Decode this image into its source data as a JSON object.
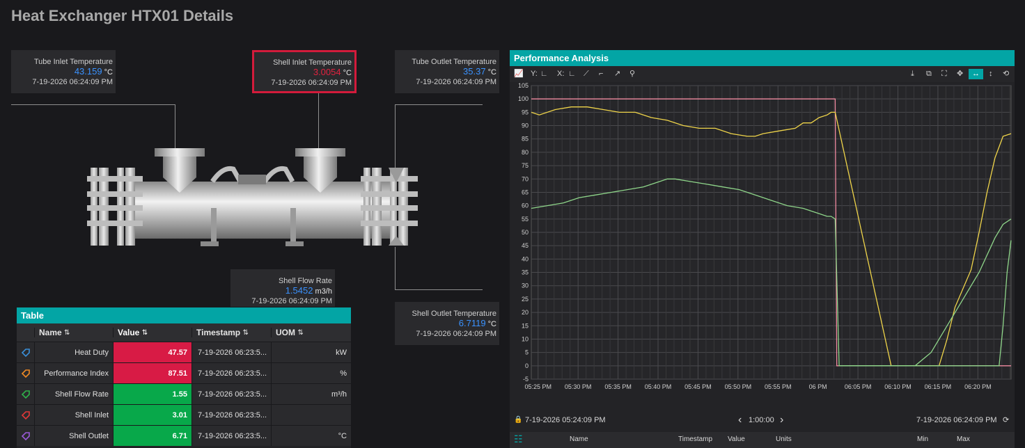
{
  "page_title": "Heat Exchanger HTX01 Details",
  "callouts": {
    "tube_inlet": {
      "label": "Tube Inlet Temperature",
      "value": "43.159",
      "unit": "°C",
      "timestamp": "7-19-2026 06:24:09 PM"
    },
    "shell_inlet": {
      "label": "Shell Inlet Temperature",
      "value": "3.0054",
      "unit": "°C",
      "timestamp": "7-19-2026 06:24:09 PM"
    },
    "tube_outlet": {
      "label": "Tube Outlet Temperature",
      "value": "35.37",
      "unit": "°C",
      "timestamp": "7-19-2026 06:24:09 PM"
    },
    "shell_flow": {
      "label": "Shell Flow Rate",
      "value": "1.5452",
      "unit": "m3/h",
      "timestamp": "7-19-2026 06:24:09 PM"
    },
    "shell_outlet": {
      "label": "Shell Outlet Temperature",
      "value": "6.7119",
      "unit": "°C",
      "timestamp": "7-19-2026 06:24:09 PM"
    }
  },
  "table": {
    "title": "Table",
    "columns": {
      "name": "Name",
      "value": "Value",
      "timestamp": "Timestamp",
      "uom": "UOM"
    },
    "sort_icons": {
      "name": "⇅",
      "value": "⇅",
      "timestamp": "⇅",
      "uom": "⇅"
    },
    "rows": [
      {
        "name": "Heat Duty",
        "value": "47.57",
        "timestamp": "7-19-2026 06:23:5...",
        "uom": "kW",
        "tag_color": "#3a8fd8",
        "value_bg": "#d81b45"
      },
      {
        "name": "Performance Index",
        "value": "87.51",
        "timestamp": "7-19-2026 06:23:5...",
        "uom": "%",
        "tag_color": "#f08a24",
        "value_bg": "#d81b45"
      },
      {
        "name": "Shell Flow Rate",
        "value": "1.55",
        "timestamp": "7-19-2026 06:23:5...",
        "uom": "m³/h",
        "tag_color": "#2fb24a",
        "value_bg": "#08a84a"
      },
      {
        "name": "Shell Inlet",
        "value": "3.01",
        "timestamp": "7-19-2026 06:23:5...",
        "uom": "",
        "tag_color": "#e03838",
        "value_bg": "#08a84a"
      },
      {
        "name": "Shell Outlet",
        "value": "6.71",
        "timestamp": "7-19-2026 06:23:5...",
        "uom": "°C",
        "tag_color": "#9a5ad8",
        "value_bg": "#08a84a"
      }
    ]
  },
  "trend": {
    "title": "Performance Analysis",
    "toolbar": {
      "y_label": "Y:",
      "x_label": "X:"
    },
    "footer": {
      "start": "7-19-2026 05:24:09 PM",
      "span": "1:00:00",
      "end": "7-19-2026 06:24:09 PM",
      "prev": "‹",
      "next": "›"
    },
    "legend_columns": [
      "Name",
      "Timestamp",
      "Value",
      "Units",
      "Min",
      "Max"
    ]
  },
  "chart_data": {
    "type": "line",
    "x_ticks": [
      "05:25 PM",
      "05:30 PM",
      "05:35 PM",
      "05:40 PM",
      "05:45 PM",
      "05:50 PM",
      "05:55 PM",
      "06 PM",
      "06:05 PM",
      "06:10 PM",
      "06:15 PM",
      "06:20 PM"
    ],
    "x_range_minutes": [
      0,
      60
    ],
    "ylim": [
      -5,
      105
    ],
    "y_ticks": [
      -5,
      0,
      5,
      10,
      15,
      20,
      25,
      30,
      35,
      40,
      45,
      50,
      55,
      60,
      65,
      70,
      75,
      80,
      85,
      90,
      95,
      100,
      105
    ],
    "grid": true,
    "series": [
      {
        "color": "#f08aa0",
        "x": [
          0,
          34,
          35,
          38,
          38.2,
          60
        ],
        "values": [
          100,
          100,
          100,
          100,
          0,
          0
        ]
      },
      {
        "color": "#f0d54a",
        "x": [
          0,
          1,
          3,
          5,
          7,
          9,
          11,
          13,
          15,
          17,
          19,
          21,
          23,
          25,
          27,
          28,
          29,
          31,
          33,
          34,
          35,
          36,
          37,
          37.5,
          38,
          45,
          51,
          52,
          53,
          55,
          56,
          57,
          58,
          59,
          60
        ],
        "values": [
          95,
          94,
          96,
          97,
          97,
          96,
          95,
          95,
          93,
          92,
          90,
          89,
          89,
          87,
          86,
          86,
          87,
          88,
          89,
          91,
          91,
          93,
          94,
          95,
          95,
          0,
          0,
          10,
          22,
          36,
          50,
          65,
          78,
          86,
          87
        ]
      },
      {
        "color": "#8fd68a",
        "x": [
          0,
          2,
          4,
          6,
          8,
          10,
          12,
          14,
          16,
          17,
          18,
          20,
          22,
          24,
          26,
          28,
          30,
          32,
          34,
          36,
          37,
          37.5,
          38,
          38.5,
          45,
          48,
          50,
          52,
          54,
          56,
          58,
          59,
          60
        ],
        "values": [
          59,
          60,
          61,
          63,
          64,
          65,
          66,
          67,
          69,
          70,
          70,
          69,
          68,
          67,
          66,
          64,
          62,
          60,
          59,
          57,
          56,
          56,
          55,
          0,
          0,
          0,
          5,
          15,
          25,
          35,
          48,
          53,
          55
        ]
      },
      {
        "color": "#8fd68a",
        "x": [
          0,
          38.5,
          45,
          48,
          50,
          52,
          54,
          56,
          58,
          58.5,
          59,
          59.5,
          60
        ],
        "values": [
          null,
          0,
          0,
          0,
          0,
          0,
          0,
          0,
          0,
          0,
          15,
          35,
          47
        ]
      }
    ]
  }
}
